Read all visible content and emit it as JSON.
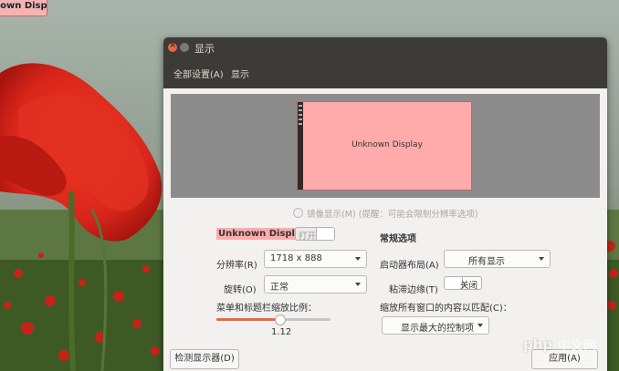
{
  "desktop": {
    "badge_text": "nown Display"
  },
  "window": {
    "title": "显示",
    "menu": {
      "all_settings": "全部设置(A)",
      "display": "显示"
    },
    "arrangement": {
      "monitor_label": "Unknown Display"
    },
    "mirror": {
      "label": "镜像显示(M)",
      "hint": "(提醒：可能会限制分辨率选项)"
    },
    "display_settings": {
      "display_name": "Unknown Display",
      "power_toggle_label": "打开",
      "resolution_label": "分辨率(R)",
      "resolution_value": "1718 x 888",
      "rotation_label": "旋转(O)",
      "rotation_value": "正常",
      "scale_label": "菜单和标题栏缩放比例：",
      "scale_value": "1.12",
      "scale_fraction": 0.55
    },
    "general": {
      "title": "常规选项",
      "launcher_label": "启动器布局(A)",
      "launcher_value": "所有显示",
      "sticky_label": "粘滞边缘(T)",
      "sticky_toggle_label": "关闭",
      "scale_all_label": "缩放所有窗口的内容以匹配(C)：",
      "scale_all_value": "显示最大的控制项"
    },
    "buttons": {
      "detect": "检测显示器(D)",
      "apply": "应用(A)"
    }
  },
  "watermark": {
    "logo_text": "php",
    "site_text": "中文网"
  },
  "colors": {
    "titlebar": "#3c3b37",
    "accent": "#e9683d",
    "monitor_fill": "#ffabab"
  }
}
